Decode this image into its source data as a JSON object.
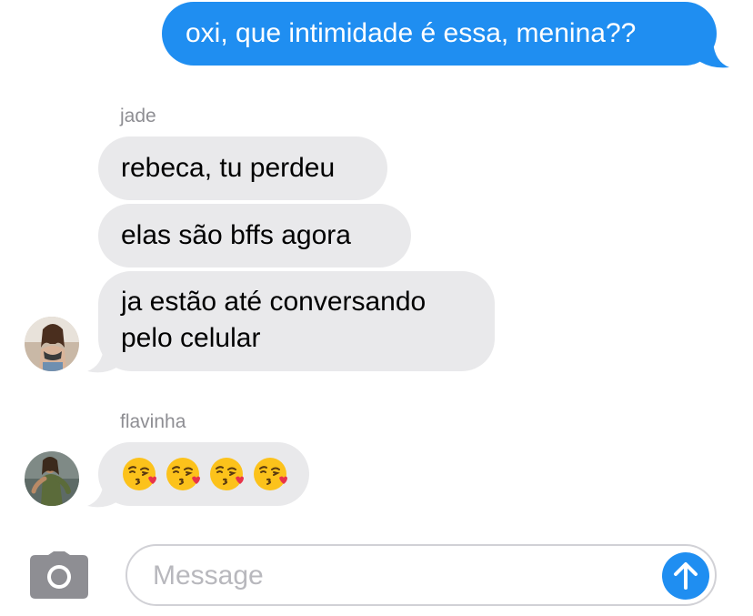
{
  "messages": {
    "sent_1": "oxi, que intimidade é essa, menina??",
    "jade_name": "jade",
    "jade_1": "rebeca, tu perdeu",
    "jade_2": "elas são bffs agora",
    "jade_3_line1": "ja estão até conversando",
    "jade_3_line2": "pelo celular",
    "flavinha_name": "flavinha",
    "flavinha_1_emoji": "kissing-face-with-heart-emoji x4"
  },
  "composer": {
    "placeholder": "Message"
  },
  "icons": {
    "camera": "camera-icon",
    "send": "arrow-up-icon"
  },
  "colors": {
    "sent_bubble": "#1f8ef1",
    "received_bubble": "#e9e9eb",
    "send_button": "#1f8ef1",
    "placeholder": "#b8b8bd",
    "sender_name": "#8e8e93"
  }
}
